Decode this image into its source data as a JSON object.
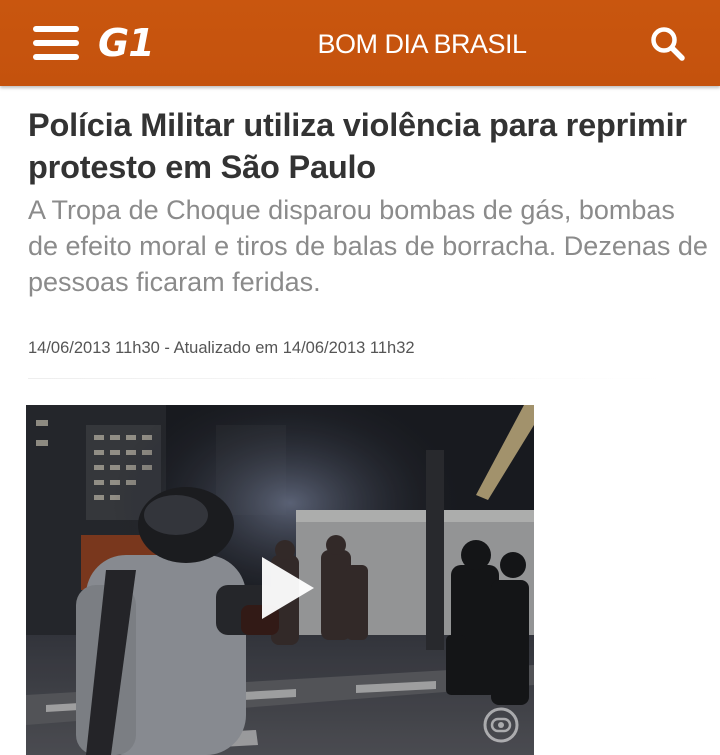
{
  "header": {
    "menu_icon": "hamburger-menu-icon",
    "logo_text": "G1",
    "section": "BOM DIA BRASIL",
    "search_icon": "search-icon",
    "bar_color": "#c9560f"
  },
  "article": {
    "headline": "Polícia Militar utiliza violência para reprimir protesto em São Paulo",
    "subtitle": "A Tropa de Choque disparou bombas de gás, bombas de efeito moral e tiros de balas de borracha. Dezenas de pessoas ficaram feridas.",
    "dateline": "14/06/2013 11h30 - Atualizado em 14/06/2013 11h32"
  },
  "video": {
    "play_icon": "play-icon",
    "watermark_icon": "globo-watermark-icon"
  }
}
